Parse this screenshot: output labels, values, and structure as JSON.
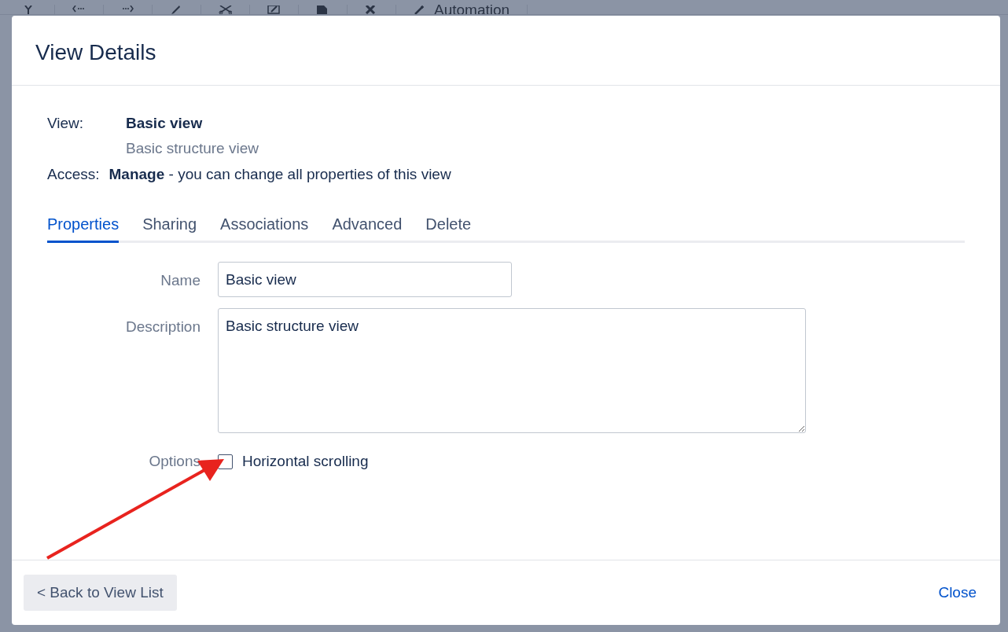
{
  "background": {
    "toolbar": {
      "label": "Automation"
    }
  },
  "dialog": {
    "title": "View Details",
    "view": {
      "label": "View:",
      "name": "Basic view",
      "description": "Basic structure view"
    },
    "access": {
      "label": "Access:",
      "text": "**Manage** - you can change all properties of this view"
    },
    "tabs": [
      {
        "label": "Properties",
        "selected": true
      },
      {
        "label": "Sharing",
        "selected": false
      },
      {
        "label": "Associations",
        "selected": false
      },
      {
        "label": "Advanced",
        "selected": false
      },
      {
        "label": "Delete",
        "selected": false
      }
    ],
    "form": {
      "name": {
        "label": "Name",
        "value": "Basic view"
      },
      "description": {
        "label": "Description",
        "value": "Basic structure view"
      },
      "options": {
        "label": "Options",
        "items": [
          {
            "label": "Horizontal scrolling",
            "checked": false
          }
        ]
      }
    },
    "footer": {
      "back_button": "< Back to View List",
      "close_link": "Close"
    }
  }
}
